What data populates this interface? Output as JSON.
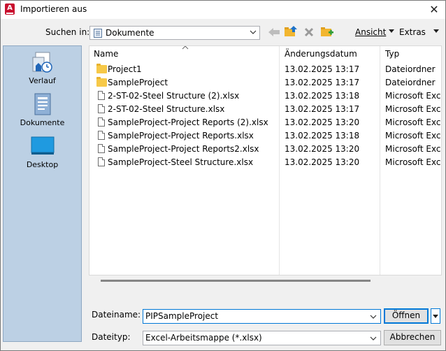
{
  "window": {
    "title": "Importieren aus",
    "close_label": "✕"
  },
  "toolbar": {
    "look_in_label": "Suchen in:",
    "look_in_value": "Dokumente",
    "view_label": "Ansicht",
    "tools_label": "Extras"
  },
  "places": [
    {
      "label": "Verlauf",
      "icon": "history-icon"
    },
    {
      "label": "Dokumente",
      "icon": "documents-icon"
    },
    {
      "label": "Desktop",
      "icon": "desktop-icon"
    }
  ],
  "columns": {
    "name": "Name",
    "date": "Änderungsdatum",
    "type": "Typ"
  },
  "files": [
    {
      "name": "Project1",
      "date": "13.02.2025 13:17",
      "type": "Dateiordner",
      "kind": "folder"
    },
    {
      "name": "SampleProject",
      "date": "13.02.2025 13:17",
      "type": "Dateiordner",
      "kind": "folder"
    },
    {
      "name": "2-ST-02-Steel Structure (2).xlsx",
      "date": "13.02.2025 13:18",
      "type": "Microsoft Excel-",
      "kind": "file"
    },
    {
      "name": "2-ST-02-Steel Structure.xlsx",
      "date": "13.02.2025 13:17",
      "type": "Microsoft Excel-",
      "kind": "file"
    },
    {
      "name": "SampleProject-Project Reports (2).xlsx",
      "date": "13.02.2025 13:20",
      "type": "Microsoft Excel-",
      "kind": "file"
    },
    {
      "name": "SampleProject-Project Reports.xlsx",
      "date": "13.02.2025 13:18",
      "type": "Microsoft Excel-",
      "kind": "file"
    },
    {
      "name": "SampleProject-Project Reports2.xlsx",
      "date": "13.02.2025 13:20",
      "type": "Microsoft Excel-",
      "kind": "file"
    },
    {
      "name": "SampleProject-Steel Structure.xlsx",
      "date": "13.02.2025 13:20",
      "type": "Microsoft Excel-",
      "kind": "file"
    }
  ],
  "footer": {
    "filename_label": "Dateiname:",
    "filename_value": "PIPSampleProject",
    "filetype_label": "Dateityp:",
    "filetype_value": "Excel-Arbeitsmappe (*.xlsx)",
    "open_label": "Öffnen",
    "cancel_label": "Abbrechen"
  }
}
